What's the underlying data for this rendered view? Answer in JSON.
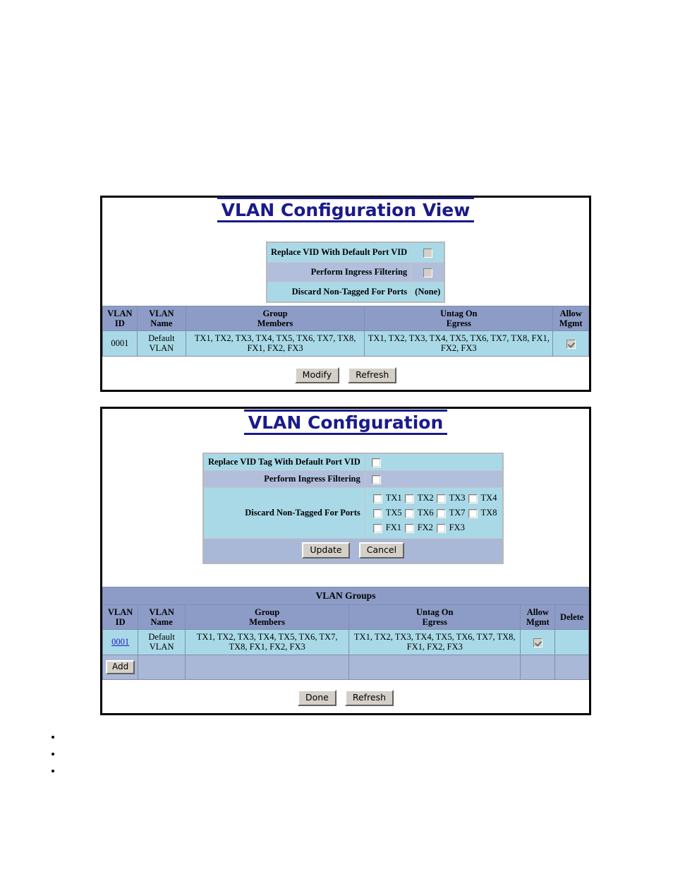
{
  "colors": {
    "title_blue": "#1a1a8c",
    "header_lavender": "#8c9cc6",
    "row_cyan": "#a9d9e7",
    "row_lavender": "#b1bfdc",
    "button_face": "#d4d0c8",
    "link_blue": "#2020c8"
  },
  "view_panel": {
    "title": "VLAN Configuration View",
    "settings": [
      {
        "label": "Replace VID With Default Port VID",
        "control": "checkbox",
        "checked": false,
        "row_style": "cyan"
      },
      {
        "label": "Perform Ingress Filtering",
        "control": "checkbox",
        "checked": false,
        "row_style": "lavender"
      },
      {
        "label": "Discard Non-Tagged For Ports",
        "control": "text",
        "value": "(None)",
        "row_style": "cyan"
      }
    ],
    "table": {
      "headers": [
        {
          "line1": "VLAN",
          "line2": "ID"
        },
        {
          "line1": "VLAN",
          "line2": "Name"
        },
        {
          "line1": "Group",
          "line2": "Members"
        },
        {
          "line1": "Untag On",
          "line2": "Egress"
        },
        {
          "line1": "Allow",
          "line2": "Mgmt"
        }
      ],
      "rows": [
        {
          "vlan_id": "0001",
          "vlan_name": "Default VLAN",
          "group_members": "TX1, TX2, TX3, TX4, TX5, TX6, TX7, TX8, FX1, FX2, FX3",
          "untag_on_egress": "TX1, TX2, TX3, TX4, TX5, TX6, TX7, TX8, FX1, FX2, FX3",
          "allow_mgmt_checked": true
        }
      ]
    },
    "buttons": {
      "modify": "Modify",
      "refresh": "Refresh"
    }
  },
  "config_panel": {
    "title": "VLAN Configuration",
    "form": {
      "replace_vid_label": "Replace VID Tag With Default Port VID",
      "replace_vid_checked": false,
      "ingress_label": "Perform Ingress Filtering",
      "ingress_checked": false,
      "discard_label": "Discard Non-Tagged For Ports",
      "ports": [
        {
          "label": "TX1",
          "checked": false
        },
        {
          "label": "TX2",
          "checked": false
        },
        {
          "label": "TX3",
          "checked": false
        },
        {
          "label": "TX4",
          "checked": false
        },
        {
          "label": "TX5",
          "checked": false
        },
        {
          "label": "TX6",
          "checked": false
        },
        {
          "label": "TX7",
          "checked": false
        },
        {
          "label": "TX8",
          "checked": false
        },
        {
          "label": "FX1",
          "checked": false
        },
        {
          "label": "FX2",
          "checked": false
        },
        {
          "label": "FX3",
          "checked": false
        }
      ],
      "buttons": {
        "update": "Update",
        "cancel": "Cancel"
      }
    },
    "groups": {
      "section_title": "VLAN Groups",
      "headers": [
        {
          "line1": "VLAN",
          "line2": "ID"
        },
        {
          "line1": "VLAN",
          "line2": "Name"
        },
        {
          "line1": "Group",
          "line2": "Members"
        },
        {
          "line1": "Untag On",
          "line2": "Egress"
        },
        {
          "line1": "Allow",
          "line2": "Mgmt"
        },
        {
          "line1": "Delete",
          "line2": ""
        }
      ],
      "rows": [
        {
          "vlan_id": "0001",
          "vlan_name": "Default VLAN",
          "group_members": "TX1, TX2, TX3, TX4, TX5, TX6, TX7, TX8, FX1, FX2, FX3",
          "untag_on_egress": "TX1, TX2, TX3, TX4, TX5, TX6, TX7, TX8, FX1, FX2, FX3",
          "allow_mgmt_checked": true,
          "delete_checked": null
        }
      ],
      "add_button": "Add"
    },
    "buttons": {
      "done": "Done",
      "refresh": "Refresh"
    }
  },
  "bullets": [
    "",
    "",
    ""
  ]
}
